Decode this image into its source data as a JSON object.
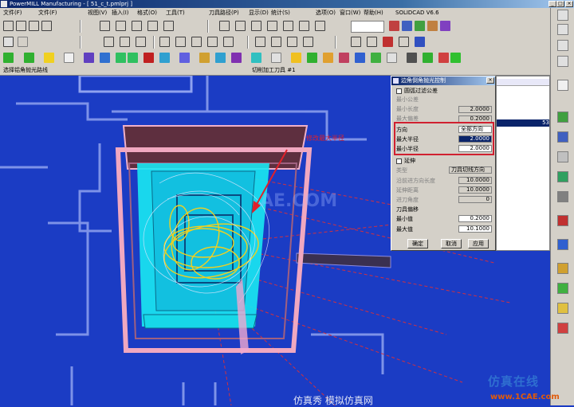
{
  "window": {
    "title": "PowerMILL Manufacturing - [ 51_c_t.pmlprj ]"
  },
  "menu": [
    "文件(F)",
    "文件(F)",
    "视图(V)",
    "插入(I)",
    "格式(O)",
    "工具(T)",
    "刀具路径(P)",
    "显示(D)",
    "统计(S)",
    "选项(O)",
    "窗口(W)",
    "帮助(H)"
  ],
  "app_version": "SOLIDCAD V6.6",
  "status": {
    "left": "选择铝角抛光路线",
    "right": "切削加工刀具 #1"
  },
  "dialog": {
    "title": "边角倒角抛光控制",
    "checkbox_top": "圆弧过滤公差",
    "top_rows": [
      {
        "label": "最小公差",
        "value": ""
      },
      {
        "label": "最小长度",
        "value": "2.0000"
      },
      {
        "label": "最大偏差",
        "value": "0.2000"
      }
    ],
    "mode_label": "方向",
    "mode_value": "全部方向",
    "radius_rows": [
      {
        "label": "最大半径",
        "value": "2.0000"
      },
      {
        "label": "最小半径",
        "value": "2.0000"
      }
    ],
    "checkbox_mid": "延伸",
    "mid_rows": [
      {
        "label": "类型",
        "value": "刀具切线方向"
      },
      {
        "label": "沿前进方向长度",
        "value": "10.0000"
      },
      {
        "label": "延伸距离",
        "value": "10.0000"
      },
      {
        "label": "进刀角度",
        "value": "0"
      }
    ],
    "section_label": "刀具偏移",
    "bottom_rows": [
      {
        "label": "最小值",
        "value": "0.2000"
      },
      {
        "label": "最大值",
        "value": "10.1000"
      }
    ],
    "buttons": [
      "确定",
      "取消",
      "应用"
    ]
  },
  "annotation": "修改最大半径",
  "list_marker": "53",
  "watermark": {
    "center": "AE.COM",
    "logo": "仿真在线",
    "url": "www.1CAE.com",
    "bottom": "仿真秀 模拟仿真网"
  },
  "colors": {
    "viewport": "#1b3cc4",
    "toolpath_cyan": "#19e8f2",
    "frame_pink": "#e0a0c0",
    "annotation_red": "#e0202a"
  }
}
